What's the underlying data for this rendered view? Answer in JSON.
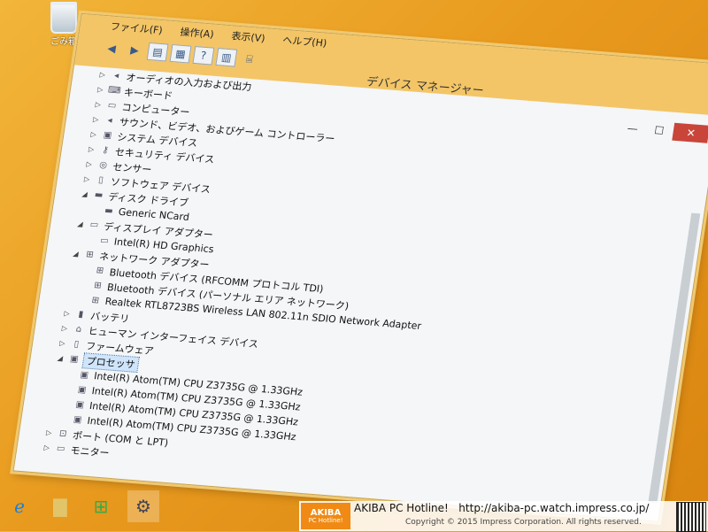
{
  "desktop": {
    "recycle_bin_label": "ごみ箱"
  },
  "window": {
    "title": "デバイス マネージャー",
    "menu": [
      "ファイル(F)",
      "操作(A)",
      "表示(V)",
      "ヘルプ(H)"
    ],
    "controls": {
      "minimize": "—",
      "maximize": "☐",
      "close": "✕"
    }
  },
  "tree": [
    {
      "text": "オーディオの入力および出力",
      "level": 1,
      "expander": "▷",
      "icon": "speaker-icon"
    },
    {
      "text": "キーボード",
      "level": 1,
      "expander": "▷",
      "icon": "keyboard-icon"
    },
    {
      "text": "コンピューター",
      "level": 1,
      "expander": "▷",
      "icon": "computer-icon"
    },
    {
      "text": "サウンド、ビデオ、およびゲーム コントローラー",
      "level": 1,
      "expander": "▷",
      "icon": "speaker-icon"
    },
    {
      "text": "システム デバイス",
      "level": 1,
      "expander": "▷",
      "icon": "system-device-icon"
    },
    {
      "text": "セキュリティ デバイス",
      "level": 1,
      "expander": "▷",
      "icon": "key-icon"
    },
    {
      "text": "センサー",
      "level": 1,
      "expander": "▷",
      "icon": "sensor-icon"
    },
    {
      "text": "ソフトウェア デバイス",
      "level": 1,
      "expander": "▷",
      "icon": "software-device-icon"
    },
    {
      "text": "ディスク ドライブ",
      "level": 1,
      "expander": "◢",
      "icon": "disk-drive-icon"
    },
    {
      "text": "Generic NCard",
      "level": 2,
      "expander": "",
      "icon": "disk-drive-icon"
    },
    {
      "text": "ディスプレイ アダプター",
      "level": 1,
      "expander": "◢",
      "icon": "monitor-icon"
    },
    {
      "text": "Intel(R) HD Graphics",
      "level": 2,
      "expander": "",
      "icon": "monitor-icon"
    },
    {
      "text": "ネットワーク アダプター",
      "level": 1,
      "expander": "◢",
      "icon": "network-icon"
    },
    {
      "text": "Bluetooth デバイス (RFCOMM プロトコル TDI)",
      "level": 2,
      "expander": "",
      "icon": "network-icon"
    },
    {
      "text": "Bluetooth デバイス (パーソナル エリア ネットワーク)",
      "level": 2,
      "expander": "",
      "icon": "network-icon"
    },
    {
      "text": "Realtek RTL8723BS Wireless LAN 802.11n SDIO Network Adapter",
      "level": 2,
      "expander": "",
      "icon": "network-icon"
    },
    {
      "text": "バッテリ",
      "level": 1,
      "expander": "▷",
      "icon": "battery-icon"
    },
    {
      "text": "ヒューマン インターフェイス デバイス",
      "level": 1,
      "expander": "▷",
      "icon": "hid-icon"
    },
    {
      "text": "ファームウェア",
      "level": 1,
      "expander": "▷",
      "icon": "firmware-icon"
    },
    {
      "text": "プロセッサ",
      "level": 1,
      "expander": "◢",
      "icon": "processor-icon",
      "selected": true
    },
    {
      "text": "Intel(R) Atom(TM) CPU  Z3735G @ 1.33GHz",
      "level": 2,
      "expander": "",
      "icon": "processor-icon"
    },
    {
      "text": "Intel(R) Atom(TM) CPU  Z3735G @ 1.33GHz",
      "level": 2,
      "expander": "",
      "icon": "processor-icon"
    },
    {
      "text": "Intel(R) Atom(TM) CPU  Z3735G @ 1.33GHz",
      "level": 2,
      "expander": "",
      "icon": "processor-icon"
    },
    {
      "text": "Intel(R) Atom(TM) CPU  Z3735G @ 1.33GHz",
      "level": 2,
      "expander": "",
      "icon": "processor-icon"
    },
    {
      "text": "ポート (COM と LPT)",
      "level": 1,
      "expander": "▷",
      "icon": "port-icon"
    },
    {
      "text": "モニター",
      "level": 1,
      "expander": "▷",
      "icon": "monitor-icon"
    }
  ],
  "watermark": {
    "logo_main": "AKIBA",
    "logo_sub": "PC Hotline!",
    "site_name": "AKIBA PC Hotline!",
    "url": "http://akiba-pc.watch.impress.co.jp/",
    "copyright": "Copyright © 2015 Impress Corporation. All rights reserved."
  }
}
